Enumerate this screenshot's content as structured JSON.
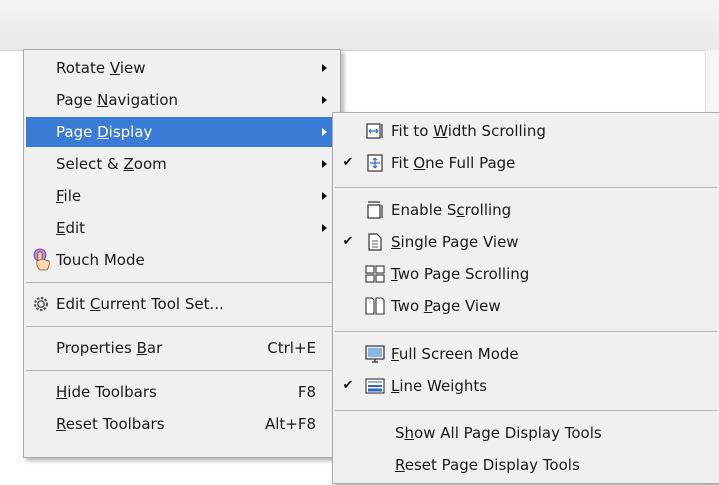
{
  "main_menu": {
    "rotate_view": {
      "pre": "Rotate ",
      "acc": "V",
      "post": "iew"
    },
    "page_navigation": {
      "pre": "Page ",
      "acc": "N",
      "post": "avigation"
    },
    "page_display": {
      "pre": "Page ",
      "acc": "D",
      "post": "isplay"
    },
    "select_zoom": {
      "pre": "Select & ",
      "acc": "Z",
      "post": "oom"
    },
    "file": {
      "pre": "",
      "acc": "F",
      "post": "ile"
    },
    "edit": {
      "pre": "",
      "acc": "E",
      "post": "dit"
    },
    "touch_mode": {
      "label": "Touch Mode"
    },
    "edit_tool_set": {
      "pre": "Edit ",
      "acc": "C",
      "post": "urrent Tool Set..."
    },
    "properties_bar": {
      "pre": "Properties ",
      "acc": "B",
      "post": "ar",
      "shortcut": "Ctrl+E"
    },
    "hide_toolbars": {
      "pre": "",
      "acc": "H",
      "post": "ide Toolbars",
      "shortcut": "F8"
    },
    "reset_toolbars": {
      "pre": "",
      "acc": "R",
      "post": "eset Toolbars",
      "shortcut": "Alt+F8"
    }
  },
  "submenu": {
    "fit_width": {
      "pre": "Fit to ",
      "acc": "W",
      "post": "idth Scrolling",
      "checked": false
    },
    "fit_page": {
      "pre": "Fit ",
      "acc": "O",
      "post": "ne Full Page",
      "checked": true
    },
    "enable_scrolling": {
      "pre": "Enable S",
      "acc": "c",
      "post": "rolling",
      "checked": false
    },
    "single_page": {
      "pre": "",
      "acc": "S",
      "post": "ingle Page View",
      "checked": true
    },
    "two_page_scrolling": {
      "pre": "",
      "acc": "T",
      "post": "wo Page Scrolling",
      "checked": false
    },
    "two_page_view": {
      "pre": "Two ",
      "acc": "P",
      "post": "age View",
      "checked": false
    },
    "full_screen": {
      "pre": "",
      "acc": "F",
      "post": "ull Screen Mode",
      "checked": false
    },
    "line_weights": {
      "pre": "",
      "acc": "L",
      "post": "ine Weights",
      "checked": true
    },
    "show_all": {
      "pre": "S",
      "acc": "h",
      "post": "ow All Page Display Tools"
    },
    "reset_tools": {
      "pre": "",
      "acc": "R",
      "post": "eset Page Display Tools"
    }
  },
  "check_glyph": "✔",
  "colors": {
    "highlight": "#3a7bd5",
    "menu_bg": "#f0f0f0",
    "separator": "#b8b8b8"
  }
}
